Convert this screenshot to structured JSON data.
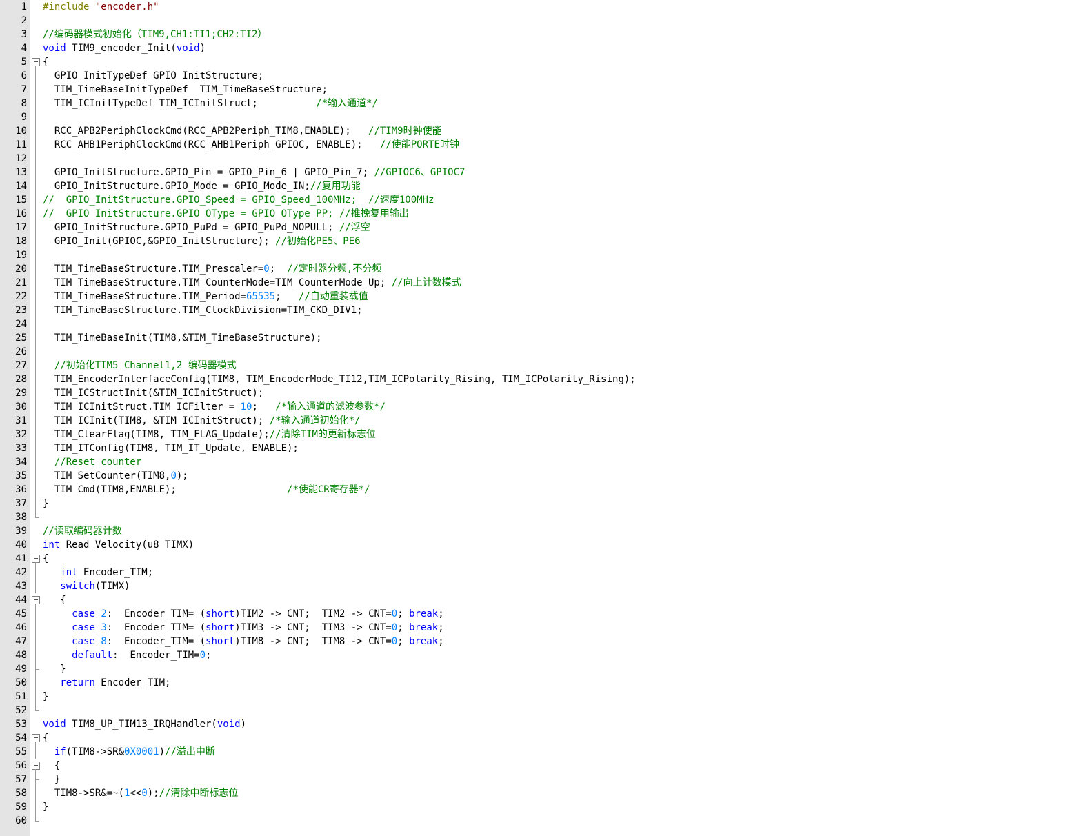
{
  "editor": {
    "colors": {
      "keyword": "#0000ff",
      "number": "#0080ff",
      "comment": "#008000",
      "preprocessor": "#808000",
      "string": "#800000",
      "gutter": "#e4e4e4"
    },
    "lines": [
      {
        "n": "1",
        "fold": "",
        "tokens": [
          {
            "t": "pp",
            "v": "#include "
          },
          {
            "t": "str",
            "v": "\"encoder.h\""
          }
        ]
      },
      {
        "n": "2",
        "fold": "",
        "tokens": []
      },
      {
        "n": "3",
        "fold": "",
        "tokens": [
          {
            "t": "com",
            "v": "//编码器模式初始化（TIM9,CH1:TI1;CH2:TI2）"
          }
        ]
      },
      {
        "n": "4",
        "fold": "",
        "tokens": [
          {
            "t": "kw",
            "v": "void"
          },
          {
            "t": "plain",
            "v": " TIM9_encoder_Init("
          },
          {
            "t": "kw",
            "v": "void"
          },
          {
            "t": "plain",
            "v": ")"
          }
        ]
      },
      {
        "n": "5",
        "fold": "open",
        "tokens": [
          {
            "t": "plain",
            "v": "{"
          }
        ]
      },
      {
        "n": "6",
        "fold": "line",
        "tokens": [
          {
            "t": "plain",
            "v": "  GPIO_InitTypeDef GPIO_InitStructure;"
          }
        ]
      },
      {
        "n": "7",
        "fold": "line",
        "tokens": [
          {
            "t": "plain",
            "v": "  TIM_TimeBaseInitTypeDef  TIM_TimeBaseStructure;"
          }
        ]
      },
      {
        "n": "8",
        "fold": "line",
        "tokens": [
          {
            "t": "plain",
            "v": "  TIM_ICInitTypeDef TIM_ICInitStruct;          "
          },
          {
            "t": "com",
            "v": "/*输入通道*/"
          }
        ]
      },
      {
        "n": "9",
        "fold": "line",
        "tokens": []
      },
      {
        "n": "10",
        "fold": "line",
        "tokens": [
          {
            "t": "plain",
            "v": "  RCC_APB2PeriphClockCmd(RCC_APB2Periph_TIM8,ENABLE);   "
          },
          {
            "t": "com",
            "v": "//TIM9时钟使能"
          }
        ]
      },
      {
        "n": "11",
        "fold": "line",
        "tokens": [
          {
            "t": "plain",
            "v": "  RCC_AHB1PeriphClockCmd(RCC_AHB1Periph_GPIOC, ENABLE);   "
          },
          {
            "t": "com",
            "v": "//使能PORTE时钟"
          }
        ]
      },
      {
        "n": "12",
        "fold": "line",
        "tokens": []
      },
      {
        "n": "13",
        "fold": "line",
        "tokens": [
          {
            "t": "plain",
            "v": "  GPIO_InitStructure.GPIO_Pin = GPIO_Pin_6 | GPIO_Pin_7; "
          },
          {
            "t": "com",
            "v": "//GPIOC6、GPIOC7"
          }
        ]
      },
      {
        "n": "14",
        "fold": "line",
        "tokens": [
          {
            "t": "plain",
            "v": "  GPIO_InitStructure.GPIO_Mode = GPIO_Mode_IN;"
          },
          {
            "t": "com",
            "v": "//复用功能"
          }
        ]
      },
      {
        "n": "15",
        "fold": "line",
        "tokens": [
          {
            "t": "com",
            "v": "//  GPIO_InitStructure.GPIO_Speed = GPIO_Speed_100MHz;  //速度100MHz"
          }
        ]
      },
      {
        "n": "16",
        "fold": "line",
        "tokens": [
          {
            "t": "com",
            "v": "//  GPIO_InitStructure.GPIO_OType = GPIO_OType_PP; //推挽复用输出"
          }
        ]
      },
      {
        "n": "17",
        "fold": "line",
        "tokens": [
          {
            "t": "plain",
            "v": "  GPIO_InitStructure.GPIO_PuPd = GPIO_PuPd_NOPULL; "
          },
          {
            "t": "com",
            "v": "//浮空"
          }
        ]
      },
      {
        "n": "18",
        "fold": "line",
        "tokens": [
          {
            "t": "plain",
            "v": "  GPIO_Init(GPIOC,&GPIO_InitStructure); "
          },
          {
            "t": "com",
            "v": "//初始化PE5、PE6"
          }
        ]
      },
      {
        "n": "19",
        "fold": "line",
        "tokens": []
      },
      {
        "n": "20",
        "fold": "line",
        "tokens": [
          {
            "t": "plain",
            "v": "  TIM_TimeBaseStructure.TIM_Prescaler="
          },
          {
            "t": "num",
            "v": "0"
          },
          {
            "t": "plain",
            "v": ";  "
          },
          {
            "t": "com",
            "v": "//定时器分频,不分频"
          }
        ]
      },
      {
        "n": "21",
        "fold": "line",
        "tokens": [
          {
            "t": "plain",
            "v": "  TIM_TimeBaseStructure.TIM_CounterMode=TIM_CounterMode_Up; "
          },
          {
            "t": "com",
            "v": "//向上计数模式"
          }
        ]
      },
      {
        "n": "22",
        "fold": "line",
        "tokens": [
          {
            "t": "plain",
            "v": "  TIM_TimeBaseStructure.TIM_Period="
          },
          {
            "t": "num",
            "v": "65535"
          },
          {
            "t": "plain",
            "v": ";   "
          },
          {
            "t": "com",
            "v": "//自动重装载值"
          }
        ]
      },
      {
        "n": "23",
        "fold": "line",
        "tokens": [
          {
            "t": "plain",
            "v": "  TIM_TimeBaseStructure.TIM_ClockDivision=TIM_CKD_DIV1;"
          }
        ]
      },
      {
        "n": "24",
        "fold": "line",
        "tokens": []
      },
      {
        "n": "25",
        "fold": "line",
        "tokens": [
          {
            "t": "plain",
            "v": "  TIM_TimeBaseInit(TIM8,&TIM_TimeBaseStructure);"
          }
        ]
      },
      {
        "n": "26",
        "fold": "line",
        "tokens": []
      },
      {
        "n": "27",
        "fold": "line",
        "tokens": [
          {
            "t": "com",
            "v": "  //初始化TIM5 Channel1,2 编码器模式"
          }
        ]
      },
      {
        "n": "28",
        "fold": "line",
        "tokens": [
          {
            "t": "plain",
            "v": "  TIM_EncoderInterfaceConfig(TIM8, TIM_EncoderMode_TI12,TIM_ICPolarity_Rising, TIM_ICPolarity_Rising);"
          }
        ]
      },
      {
        "n": "29",
        "fold": "line",
        "tokens": [
          {
            "t": "plain",
            "v": "  TIM_ICStructInit(&TIM_ICInitStruct);"
          }
        ]
      },
      {
        "n": "30",
        "fold": "line",
        "tokens": [
          {
            "t": "plain",
            "v": "  TIM_ICInitStruct.TIM_ICFilter = "
          },
          {
            "t": "num",
            "v": "10"
          },
          {
            "t": "plain",
            "v": ";   "
          },
          {
            "t": "com",
            "v": "/*输入通道的滤波参数*/"
          }
        ]
      },
      {
        "n": "31",
        "fold": "line",
        "tokens": [
          {
            "t": "plain",
            "v": "  TIM_ICInit(TIM8, &TIM_ICInitStruct); "
          },
          {
            "t": "com",
            "v": "/*输入通道初始化*/"
          }
        ]
      },
      {
        "n": "32",
        "fold": "line",
        "tokens": [
          {
            "t": "plain",
            "v": "  TIM_ClearFlag(TIM8, TIM_FLAG_Update);"
          },
          {
            "t": "com",
            "v": "//清除TIM的更新标志位"
          }
        ]
      },
      {
        "n": "33",
        "fold": "line",
        "tokens": [
          {
            "t": "plain",
            "v": "  TIM_ITConfig(TIM8, TIM_IT_Update, ENABLE);"
          }
        ]
      },
      {
        "n": "34",
        "fold": "line",
        "tokens": [
          {
            "t": "com",
            "v": "  //Reset counter"
          }
        ]
      },
      {
        "n": "35",
        "fold": "line",
        "tokens": [
          {
            "t": "plain",
            "v": "  TIM_SetCounter(TIM8,"
          },
          {
            "t": "num",
            "v": "0"
          },
          {
            "t": "plain",
            "v": ");"
          }
        ]
      },
      {
        "n": "36",
        "fold": "line",
        "tokens": [
          {
            "t": "plain",
            "v": "  TIM_Cmd(TIM8,ENABLE);                   "
          },
          {
            "t": "com",
            "v": "/*使能CR寄存器*/"
          }
        ]
      },
      {
        "n": "37",
        "fold": "line",
        "tokens": [
          {
            "t": "plain",
            "v": "}"
          }
        ]
      },
      {
        "n": "38",
        "fold": "end",
        "tokens": []
      },
      {
        "n": "39",
        "fold": "",
        "tokens": [
          {
            "t": "com",
            "v": "//读取编码器计数"
          }
        ]
      },
      {
        "n": "40",
        "fold": "",
        "tokens": [
          {
            "t": "kw",
            "v": "int"
          },
          {
            "t": "plain",
            "v": " Read_Velocity(u8 TIMX)"
          }
        ]
      },
      {
        "n": "41",
        "fold": "open",
        "tokens": [
          {
            "t": "plain",
            "v": "{"
          }
        ]
      },
      {
        "n": "42",
        "fold": "line",
        "tokens": [
          {
            "t": "plain",
            "v": "   "
          },
          {
            "t": "kw",
            "v": "int"
          },
          {
            "t": "plain",
            "v": " Encoder_TIM;"
          }
        ]
      },
      {
        "n": "43",
        "fold": "line",
        "tokens": [
          {
            "t": "plain",
            "v": "   "
          },
          {
            "t": "kw",
            "v": "switch"
          },
          {
            "t": "plain",
            "v": "(TIMX)"
          }
        ]
      },
      {
        "n": "44",
        "fold": "open",
        "tokens": [
          {
            "t": "plain",
            "v": "   {"
          }
        ]
      },
      {
        "n": "45",
        "fold": "line",
        "tokens": [
          {
            "t": "plain",
            "v": "     "
          },
          {
            "t": "kw",
            "v": "case"
          },
          {
            "t": "plain",
            "v": " "
          },
          {
            "t": "num",
            "v": "2"
          },
          {
            "t": "plain",
            "v": ":  Encoder_TIM= ("
          },
          {
            "t": "kw",
            "v": "short"
          },
          {
            "t": "plain",
            "v": ")TIM2 -> CNT;  TIM2 -> CNT="
          },
          {
            "t": "num",
            "v": "0"
          },
          {
            "t": "plain",
            "v": "; "
          },
          {
            "t": "kw",
            "v": "break"
          },
          {
            "t": "plain",
            "v": ";"
          }
        ]
      },
      {
        "n": "46",
        "fold": "line",
        "tokens": [
          {
            "t": "plain",
            "v": "     "
          },
          {
            "t": "kw",
            "v": "case"
          },
          {
            "t": "plain",
            "v": " "
          },
          {
            "t": "num",
            "v": "3"
          },
          {
            "t": "plain",
            "v": ":  Encoder_TIM= ("
          },
          {
            "t": "kw",
            "v": "short"
          },
          {
            "t": "plain",
            "v": ")TIM3 -> CNT;  TIM3 -> CNT="
          },
          {
            "t": "num",
            "v": "0"
          },
          {
            "t": "plain",
            "v": "; "
          },
          {
            "t": "kw",
            "v": "break"
          },
          {
            "t": "plain",
            "v": ";"
          }
        ]
      },
      {
        "n": "47",
        "fold": "line",
        "tokens": [
          {
            "t": "plain",
            "v": "     "
          },
          {
            "t": "kw",
            "v": "case"
          },
          {
            "t": "plain",
            "v": " "
          },
          {
            "t": "num",
            "v": "8"
          },
          {
            "t": "plain",
            "v": ":  Encoder_TIM= ("
          },
          {
            "t": "kw",
            "v": "short"
          },
          {
            "t": "plain",
            "v": ")TIM8 -> CNT;  TIM8 -> CNT="
          },
          {
            "t": "num",
            "v": "0"
          },
          {
            "t": "plain",
            "v": "; "
          },
          {
            "t": "kw",
            "v": "break"
          },
          {
            "t": "plain",
            "v": ";"
          }
        ]
      },
      {
        "n": "48",
        "fold": "line",
        "tokens": [
          {
            "t": "plain",
            "v": "     "
          },
          {
            "t": "kw",
            "v": "default"
          },
          {
            "t": "plain",
            "v": ":  Encoder_TIM="
          },
          {
            "t": "num",
            "v": "0"
          },
          {
            "t": "plain",
            "v": ";"
          }
        ]
      },
      {
        "n": "49",
        "fold": "end-inner",
        "tokens": [
          {
            "t": "plain",
            "v": "   }"
          }
        ]
      },
      {
        "n": "50",
        "fold": "line",
        "tokens": [
          {
            "t": "plain",
            "v": "   "
          },
          {
            "t": "kw",
            "v": "return"
          },
          {
            "t": "plain",
            "v": " Encoder_TIM;"
          }
        ]
      },
      {
        "n": "51",
        "fold": "line",
        "tokens": [
          {
            "t": "plain",
            "v": "}"
          }
        ]
      },
      {
        "n": "52",
        "fold": "end",
        "tokens": []
      },
      {
        "n": "53",
        "fold": "",
        "tokens": [
          {
            "t": "kw",
            "v": "void"
          },
          {
            "t": "plain",
            "v": " TIM8_UP_TIM13_IRQHandler("
          },
          {
            "t": "kw",
            "v": "void"
          },
          {
            "t": "plain",
            "v": ")"
          }
        ]
      },
      {
        "n": "54",
        "fold": "open",
        "tokens": [
          {
            "t": "plain",
            "v": "{"
          }
        ]
      },
      {
        "n": "55",
        "fold": "line",
        "tokens": [
          {
            "t": "plain",
            "v": "  "
          },
          {
            "t": "kw",
            "v": "if"
          },
          {
            "t": "plain",
            "v": "(TIM8->SR&"
          },
          {
            "t": "num",
            "v": "0X0001"
          },
          {
            "t": "plain",
            "v": ")"
          },
          {
            "t": "com",
            "v": "//溢出中断"
          }
        ]
      },
      {
        "n": "56",
        "fold": "open",
        "tokens": [
          {
            "t": "plain",
            "v": "  {"
          }
        ]
      },
      {
        "n": "57",
        "fold": "end-inner",
        "tokens": [
          {
            "t": "plain",
            "v": "  }"
          }
        ]
      },
      {
        "n": "58",
        "fold": "line",
        "tokens": [
          {
            "t": "plain",
            "v": "  TIM8->SR&=~("
          },
          {
            "t": "num",
            "v": "1"
          },
          {
            "t": "plain",
            "v": "<<"
          },
          {
            "t": "num",
            "v": "0"
          },
          {
            "t": "plain",
            "v": ");"
          },
          {
            "t": "com",
            "v": "//清除中断标志位"
          }
        ]
      },
      {
        "n": "59",
        "fold": "line",
        "tokens": [
          {
            "t": "plain",
            "v": "}"
          }
        ]
      },
      {
        "n": "60",
        "fold": "end",
        "tokens": []
      }
    ]
  }
}
